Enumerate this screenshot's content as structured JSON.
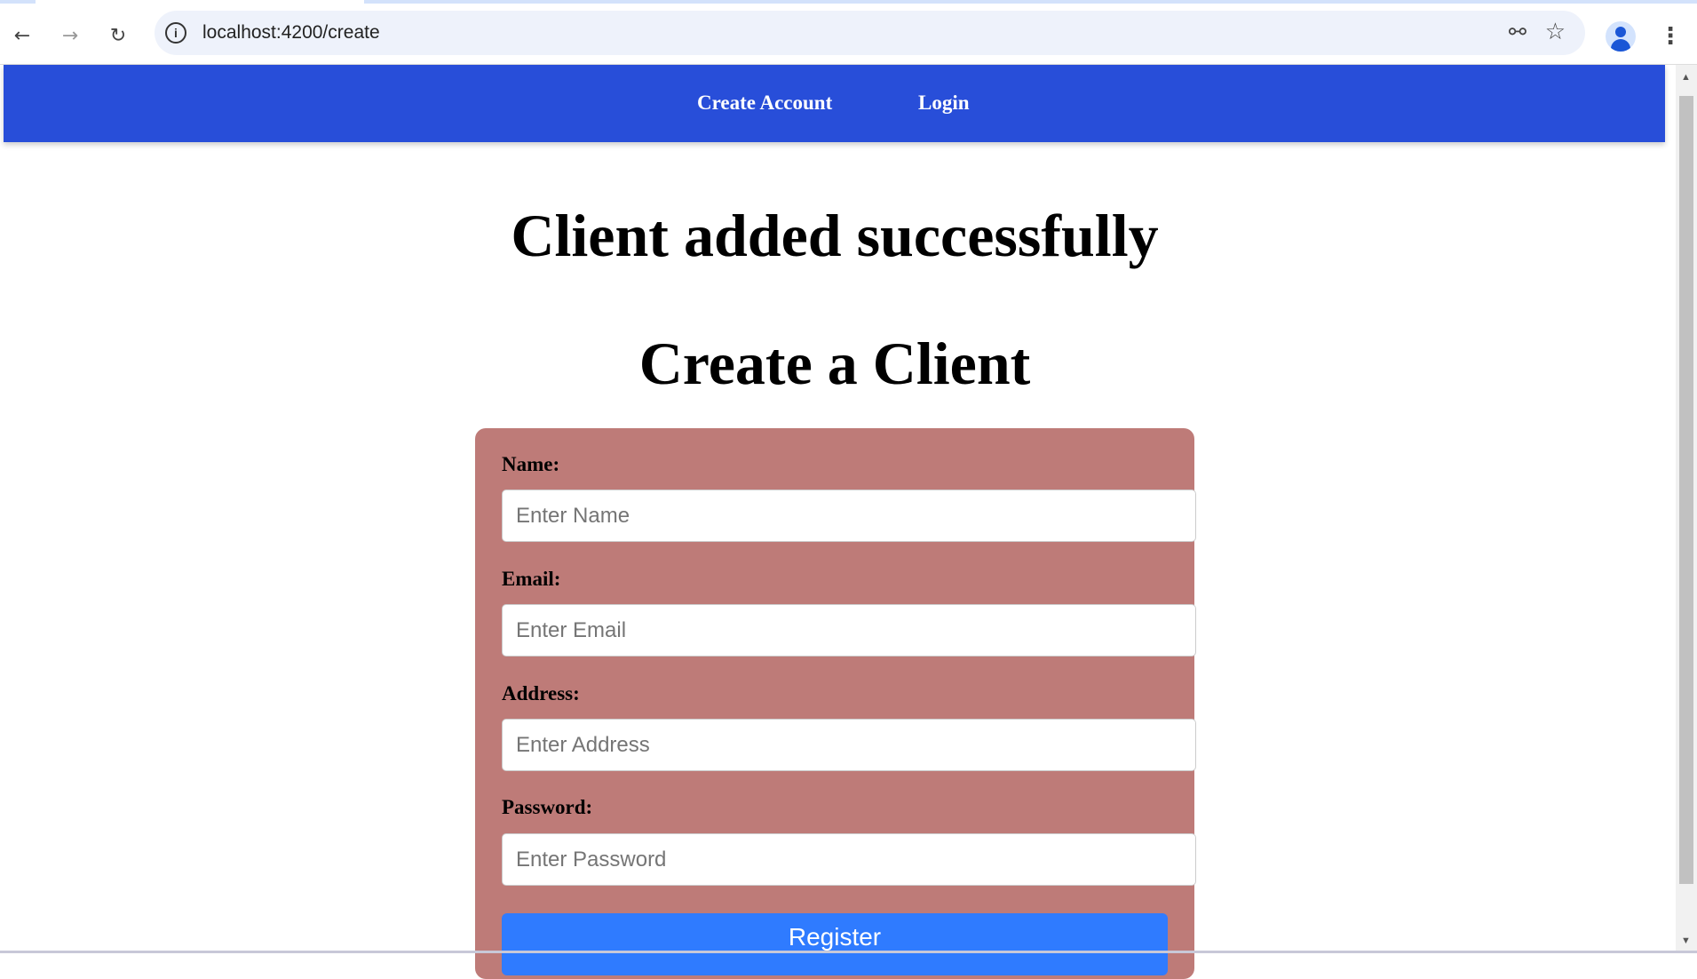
{
  "browser": {
    "url": "localhost:4200/create",
    "icons": [
      "back-icon",
      "forward-icon",
      "reload-icon",
      "info-icon",
      "key-icon",
      "star-icon",
      "profile-icon",
      "menu-icon"
    ]
  },
  "nav": {
    "links": [
      {
        "label": "Create Account"
      },
      {
        "label": "Login"
      }
    ]
  },
  "main": {
    "success_message": "Client added successfully",
    "title": "Create a Client",
    "form": {
      "fields": [
        {
          "label": "Name:",
          "placeholder": "Enter Name",
          "value": ""
        },
        {
          "label": "Email:",
          "placeholder": "Enter Email",
          "value": ""
        },
        {
          "label": "Address:",
          "placeholder": "Enter Address",
          "value": ""
        },
        {
          "label": "Password:",
          "placeholder": "Enter Password",
          "value": ""
        }
      ],
      "submit_label": "Register"
    }
  },
  "colors": {
    "nav": "#284ed9",
    "card": "#be7b78",
    "button": "#2f7bff"
  }
}
